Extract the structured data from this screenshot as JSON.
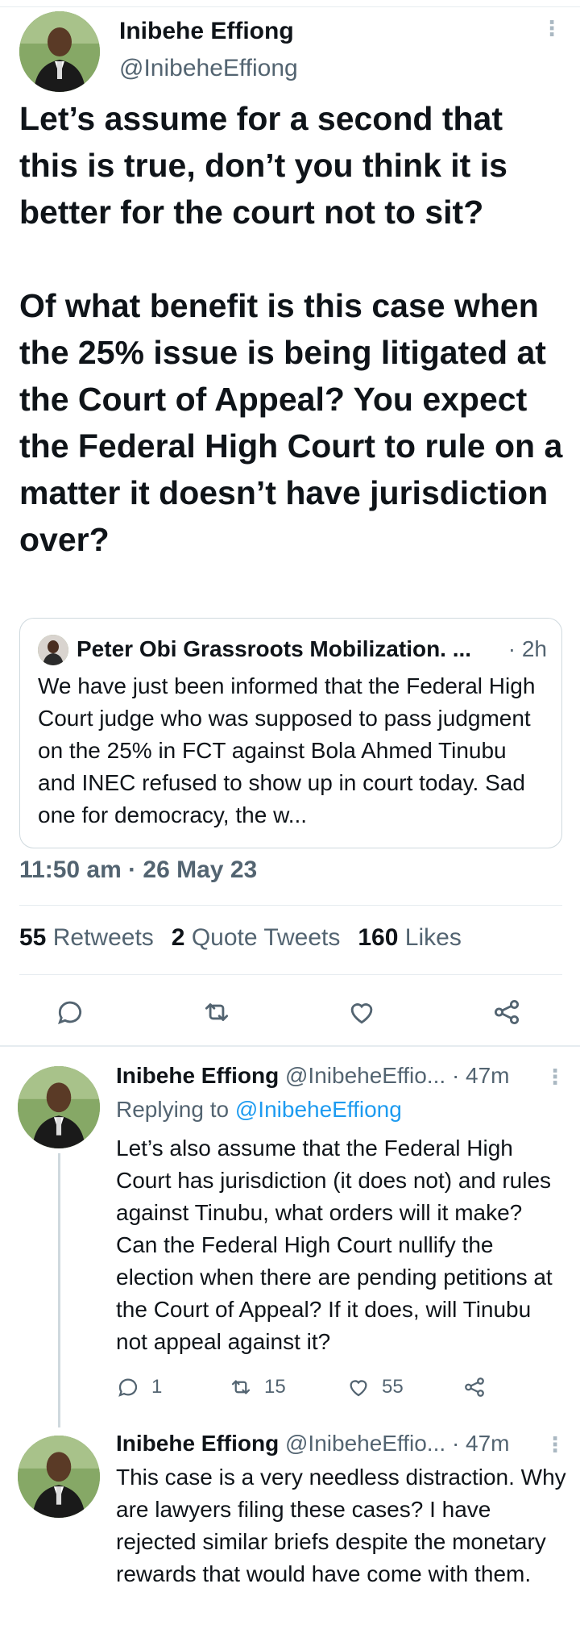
{
  "main_tweet": {
    "author_name": "Inibehe Effiong",
    "author_handle": "@InibeheEffiong",
    "text": "Let’s assume for a second that this is true, don’t you think it is better for the court not to sit?\n\nOf what benefit is this case when the 25% issue is being litigated at the Court of Appeal? You expect the Federal High Court to rule on a matter it doesn’t have jurisdiction over?",
    "quoted": {
      "author_name": "Peter Obi Grassroots Mobilization. ...",
      "time": "· 2h",
      "text": "We have just been informed that the Federal High Court judge who was supposed to pass judgment on the 25% in FCT against Bola Ahmed Tinubu and INEC refused to show up in court today. Sad one for democracy, the w..."
    },
    "timestamp": "11:50 am · 26 May 23",
    "stats": {
      "retweets_count": "55",
      "retweets_label": "Retweets",
      "quotes_count": "2",
      "quotes_label": "Quote Tweets",
      "likes_count": "160",
      "likes_label": "Likes"
    }
  },
  "replies": [
    {
      "author_name": "Inibehe Effiong",
      "author_handle": "@InibeheEffio...",
      "time": "· 47m",
      "replying_prefix": "Replying to",
      "replying_to": "@InibeheEffiong",
      "text": "Let’s also assume that the Federal High Court has jurisdiction (it does not) and rules against Tinubu, what orders will it make? Can the Federal High Court nullify the election when there are pending petitions at the Court of Appeal? If it does, will Tinubu not appeal against it?",
      "reply_count": "1",
      "retweet_count": "15",
      "like_count": "55"
    },
    {
      "author_name": "Inibehe Effiong",
      "author_handle": "@InibeheEffio...",
      "time": "· 47m",
      "text": "This case is a very needless distraction. Why are lawyers filing these cases? I have rejected similar briefs despite the monetary rewards that would have come with them."
    }
  ],
  "colors": {
    "text_primary": "#0f1419",
    "text_secondary": "#536471",
    "link_blue": "#1d9bf0",
    "divider": "#e6ecf0"
  },
  "icons": {
    "reply": "speech-bubble-icon",
    "retweet": "retweet-arrows-icon",
    "like": "heart-icon",
    "share": "share-nodes-icon",
    "more": "vertical-dots-icon"
  }
}
